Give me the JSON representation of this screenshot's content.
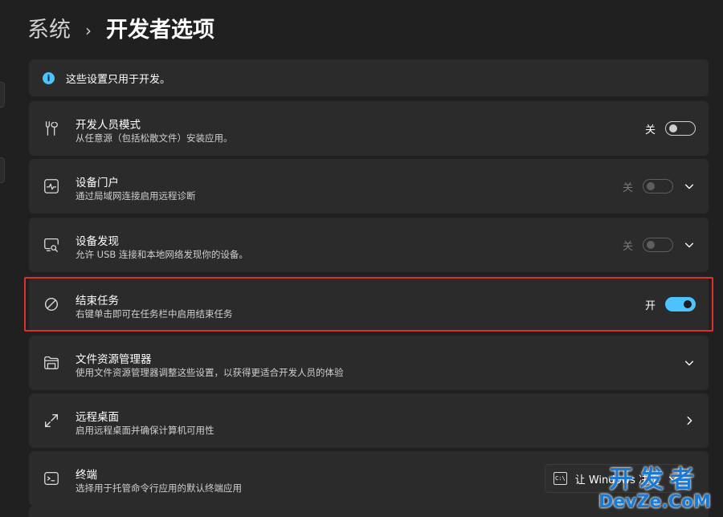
{
  "breadcrumb": {
    "parent": "系统",
    "separator": "›",
    "current": "开发者选项"
  },
  "info": {
    "icon": "info-icon",
    "glyph": "i",
    "text": "这些设置只用于开发。"
  },
  "settings": [
    {
      "icon": "developer-tools-icon",
      "title": "开发人员模式",
      "description": "从任意源（包括松散文件）安装应用。",
      "state_label": "关",
      "toggle_on": false,
      "enabled": true
    },
    {
      "icon": "device-portal-icon",
      "title": "设备门户",
      "description": "通过局域网连接启用远程诊断",
      "state_label": "关",
      "toggle_on": false,
      "enabled": false
    },
    {
      "icon": "device-discovery-icon",
      "title": "设备发现",
      "description": "允许 USB 连接和本地网络发现你的设备。",
      "state_label": "关",
      "toggle_on": false,
      "enabled": false
    },
    {
      "icon": "end-task-icon",
      "title": "结束任务",
      "description": "右键单击即可在任务栏中启用结束任务",
      "state_label": "开",
      "toggle_on": true,
      "enabled": true
    },
    {
      "icon": "file-explorer-icon",
      "title": "文件资源管理器",
      "description": "使用文件资源管理器调整这些设置，以获得更适合开发人员的体验"
    },
    {
      "icon": "remote-desktop-icon",
      "title": "远程桌面",
      "description": "启用远程桌面并确保计算机可用性"
    },
    {
      "icon": "terminal-icon",
      "title": "终端",
      "description": "选择用于托管命令行应用的默认终端应用",
      "select_value": "让 Windows 决定",
      "select_glyph": "C:\\"
    }
  ],
  "watermark": {
    "line1": "开发者",
    "line2": "DevZe.CoM"
  },
  "colors": {
    "background": "#202020",
    "card": "#2b2b2b",
    "accent": "#4cc2ff",
    "highlight": "#e0302a"
  }
}
